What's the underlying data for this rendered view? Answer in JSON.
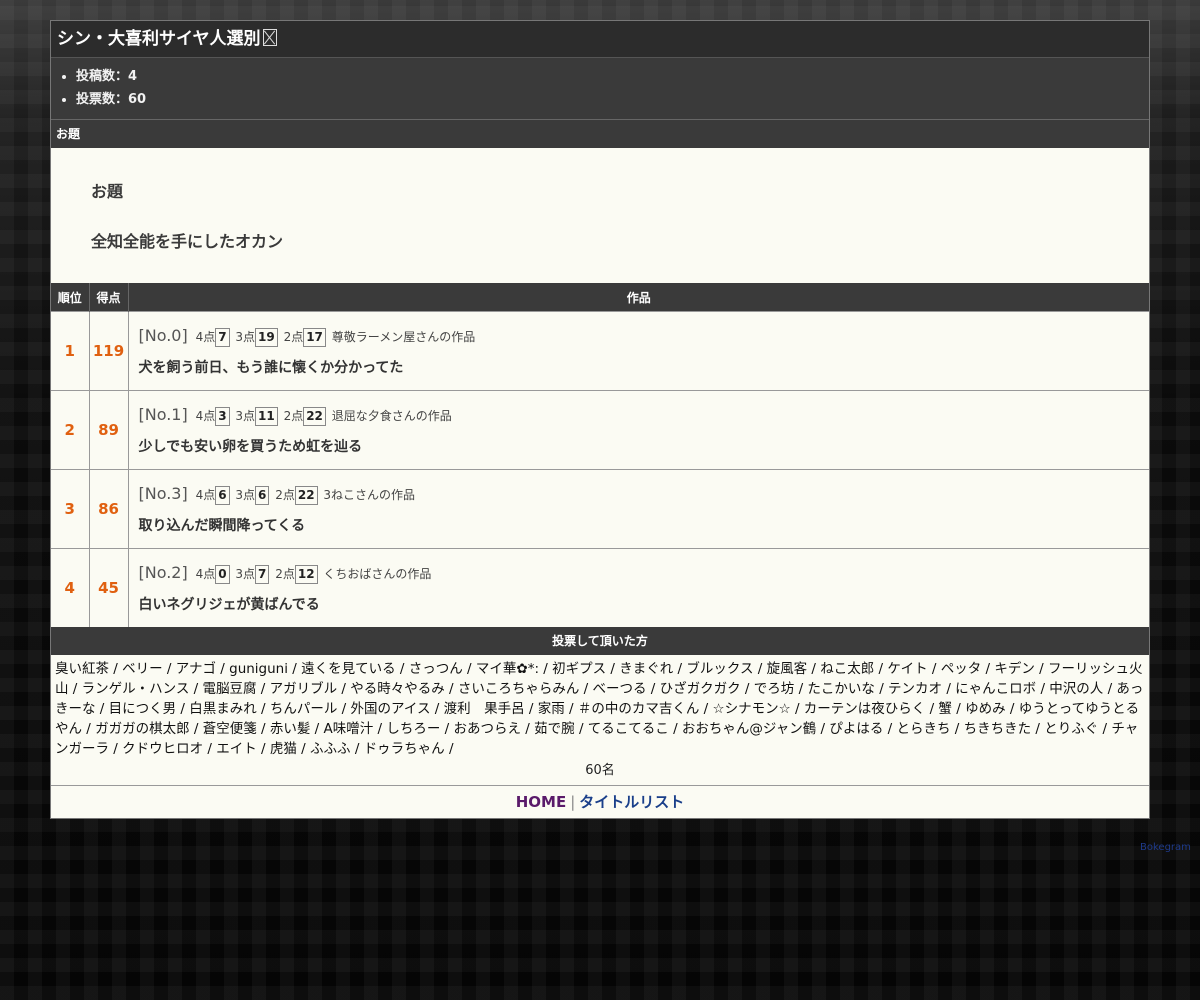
{
  "page": {
    "title": "シン・大喜利サイヤ人選別",
    "stats": [
      {
        "label": "投稿数：4"
      },
      {
        "label": "投票数：60"
      }
    ]
  },
  "odai_section": {
    "header": "お題",
    "label": "お題",
    "theme": "全知全能を手にしたオカン"
  },
  "results": {
    "columns": {
      "rank": "順位",
      "score": "得点",
      "work": "作品"
    },
    "rows": [
      {
        "rank": "1",
        "score": "119",
        "no": "[No.0]",
        "p4_label": "4点",
        "p4": "7",
        "p3_label": "3点",
        "p3": "19",
        "p2_label": "2点",
        "p2": "17",
        "author": "尊敬ラーメン屋さんの作品",
        "text": "犬を飼う前日、もう誰に懐くか分かってた"
      },
      {
        "rank": "2",
        "score": "89",
        "no": "[No.1]",
        "p4_label": "4点",
        "p4": "3",
        "p3_label": "3点",
        "p3": "11",
        "p2_label": "2点",
        "p2": "22",
        "author": "退屈な夕食さんの作品",
        "text": "少しでも安い卵を買うため虹を辿る"
      },
      {
        "rank": "3",
        "score": "86",
        "no": "[No.3]",
        "p4_label": "4点",
        "p4": "6",
        "p3_label": "3点",
        "p3": "6",
        "p2_label": "2点",
        "p2": "22",
        "author": "3ねこさんの作品",
        "text": "取り込んだ瞬間降ってくる"
      },
      {
        "rank": "4",
        "score": "45",
        "no": "[No.2]",
        "p4_label": "4点",
        "p4": "0",
        "p3_label": "3点",
        "p3": "7",
        "p2_label": "2点",
        "p2": "12",
        "author": "くちおばさんの作品",
        "text": "白いネグリジェが黄ばんでる"
      }
    ]
  },
  "voters": {
    "header": "投票して頂いた方",
    "list": "臭い紅茶 / ベリー / アナゴ / guniguni / 遠くを見ている / さっつん / マイ華✿*: / 初ギプス / きまぐれ / ブルックス / 旋風客 / ねこ太郎 / ケイト / ペッタ / キデン / フーリッシュ火山 / ランゲル・ハンス / 電脳豆腐 / アガリブル / やる時々やるみ / さいころちゃらみん / べーつる / ひざガクガク / でろ坊 / たこかいな / テンカオ / にゃんこロボ / 中沢の人 / あっきーな / 目につく男 / 白黒まみれ / ちんパール / 外国のアイス / 渡利　果手呂 / 家雨 / ＃の中のカマ吉くん / ☆シナモン☆ / カーテンは夜ひらく / 蟹 / ゆめみ / ゆうとってゆうとるやん / ガガガの棋太郎 / 蒼空便箋 / 赤い髪 / A味噌汁 / しちろー / おあつらえ / 茹で腕 / てるこてるこ / おおちゃん@ジャン鶴 / ぴよはる / とらきち / ちきちきた / とりふぐ / チャンガーラ / クドウヒロオ / エイト / 虎猫 / ふふふ / ドゥラちゃん /",
    "count": "60名"
  },
  "footer": {
    "home": "HOME",
    "separator": "|",
    "title_list": "タイトルリスト"
  },
  "brand": "Bokegram",
  "colors": {
    "score": "#e06010",
    "header_bg": "#3a3a3a",
    "panel_bg": "#fbfbf3",
    "home_link": "#5a1a6a",
    "title_list_link": "#1a3f8a"
  }
}
